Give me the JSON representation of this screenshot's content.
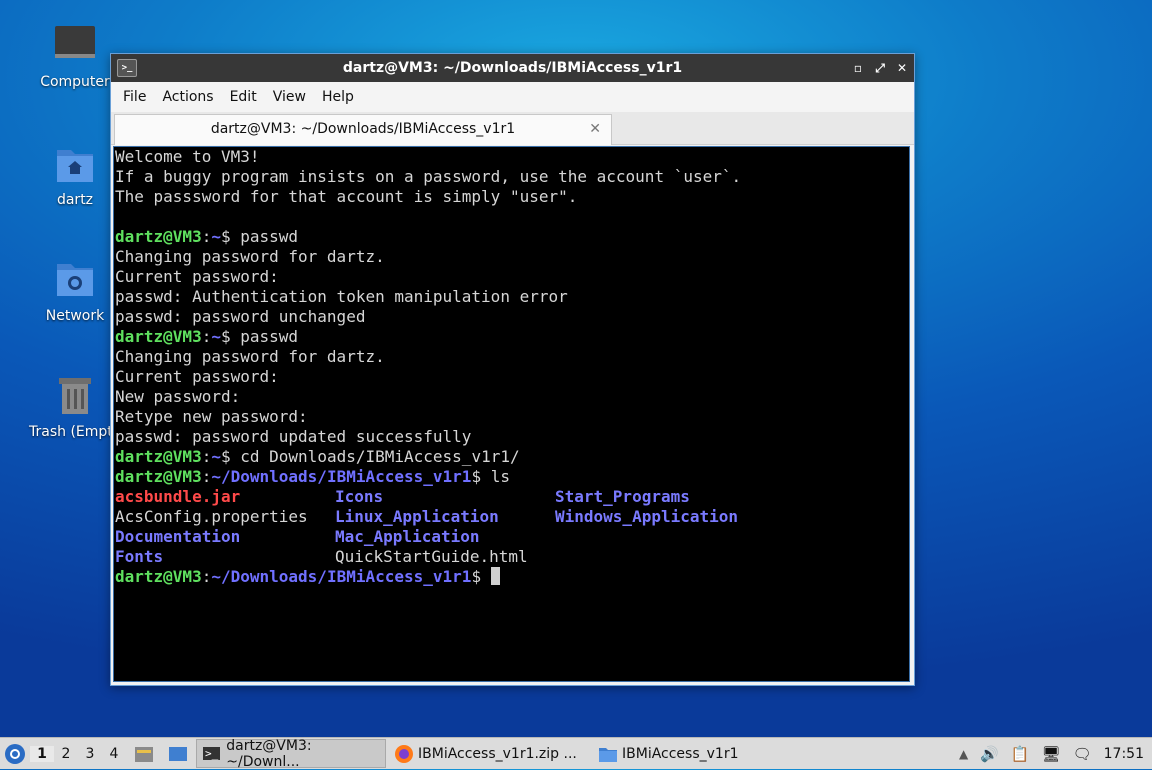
{
  "desktop": {
    "icons": [
      {
        "label": "Computer"
      },
      {
        "label": "dartz"
      },
      {
        "label": "Network"
      },
      {
        "label": "Trash (Empty)"
      }
    ]
  },
  "window": {
    "title": "dartz@VM3: ~/Downloads/IBMiAccess_v1r1",
    "menu": [
      "File",
      "Actions",
      "Edit",
      "View",
      "Help"
    ],
    "tab_label": "dartz@VM3: ~/Downloads/IBMiAccess_v1r1"
  },
  "terminal": {
    "motd": [
      "Welcome to VM3!",
      "If a buggy program insists on a password, use the account `user`.",
      "The passsword for that account is simply \"user\"."
    ],
    "prompt_user": "dartz@VM3",
    "home_path": "~",
    "dl_path": "~/Downloads/IBMiAccess_v1r1",
    "cmd1": "passwd",
    "out1": [
      "Changing password for dartz.",
      "Current password:",
      "passwd: Authentication token manipulation error",
      "passwd: password unchanged"
    ],
    "cmd2": "passwd",
    "out2": [
      "Changing password for dartz.",
      "Current password:",
      "New password:",
      "Retype new password:",
      "passwd: password updated successfully"
    ],
    "cmd3": "cd Downloads/IBMiAccess_v1r1/",
    "cmd4": "ls",
    "ls": {
      "col1": [
        "acsbundle.jar",
        "AcsConfig.properties",
        "Documentation",
        "Fonts"
      ],
      "col2": [
        "Icons",
        "Linux_Application",
        "Mac_Application",
        "QuickStartGuide.html"
      ],
      "col3": [
        "Start_Programs",
        "Windows_Application"
      ]
    }
  },
  "taskbar": {
    "workspaces": [
      "1",
      "2",
      "3",
      "4"
    ],
    "tasks": [
      {
        "label": "dartz@VM3: ~/Downl..."
      },
      {
        "label": "IBMiAccess_v1r1.zip ..."
      },
      {
        "label": "IBMiAccess_v1r1"
      }
    ],
    "clock": "17:51"
  }
}
